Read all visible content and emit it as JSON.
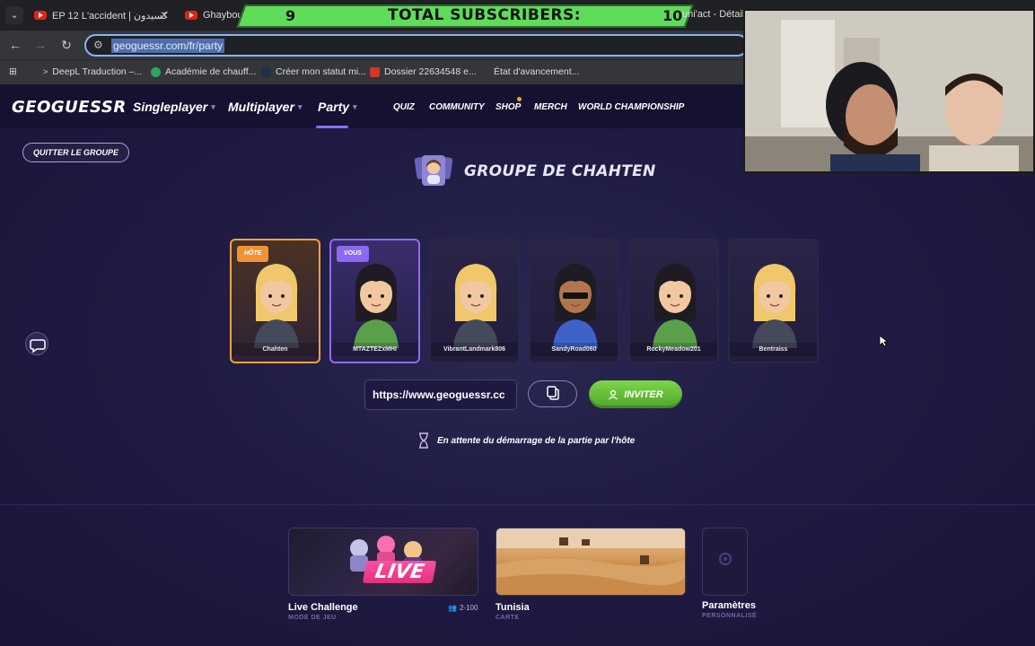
{
  "browser": {
    "tabs": [
      {
        "label": "EP 12 L'accident | كسيدون"
      },
      {
        "label": "Ghaybouba a"
      }
    ],
    "tab_right_text": "uni'act - Détails",
    "url": "geoguessr.com/fr/party",
    "bookmarks": [
      {
        "label": "DeepL Traduction –..."
      },
      {
        "label": "Académie de chauff..."
      },
      {
        "label": "Créer mon statut mi..."
      },
      {
        "label": "Dossier 22634548 e..."
      },
      {
        "label": "État d'avancement..."
      }
    ]
  },
  "subscriber_banner": {
    "left_count": "9",
    "title": "TOTAL SUBSCRIBERS:",
    "right_count": "10"
  },
  "header": {
    "logo": "GEOGUESSR",
    "nav_main": [
      {
        "label": "Singleplayer"
      },
      {
        "label": "Multiplayer"
      },
      {
        "label": "Party"
      }
    ],
    "nav_small": [
      {
        "label": "QUIZ"
      },
      {
        "label": "COMMUNITY"
      },
      {
        "label": "SHOP"
      },
      {
        "label": "MERCH"
      },
      {
        "label": "WORLD CHAMPIONSHIP"
      }
    ]
  },
  "party": {
    "quit_label": "QUITTER LE GROUPE",
    "title": "GROUPE DE CHAHTEN",
    "players": [
      {
        "name": "Chahten",
        "badge": "HÔTE",
        "hair": "#f0c76a",
        "shirt": "#444a5a",
        "skin": "#f2c8a0"
      },
      {
        "name": "MTAZTEZxMHI",
        "badge": "VOUS",
        "hair": "#1e1b22",
        "shirt": "#5aa04a",
        "skin": "#f2c8a0"
      },
      {
        "name": "VibrantLandmark806",
        "badge": "",
        "hair": "#f0c76a",
        "shirt": "#444a5a",
        "skin": "#f2c8a0"
      },
      {
        "name": "SandyRoad060",
        "badge": "",
        "hair": "#1e1b22",
        "shirt": "#3d63c9",
        "skin": "#b27550"
      },
      {
        "name": "RockyMeadow201",
        "badge": "",
        "hair": "#1e1b22",
        "shirt": "#5aa04a",
        "skin": "#f2c8a0"
      },
      {
        "name": "Bentraiss",
        "badge": "",
        "hair": "#f0c76a",
        "shirt": "#444a5a",
        "skin": "#f2c8a0"
      }
    ],
    "invite_url": "https://www.geoguessr.cc",
    "invite_label": "INVITER",
    "waiting_text": "En attente du démarrage de la partie par l'hôte"
  },
  "settings_cards": [
    {
      "title": "Live Challenge",
      "sub": "MODE DE JEU",
      "image_text": "LIVE",
      "players": "2-100"
    },
    {
      "title": "Tunisia",
      "sub": "CARTE"
    },
    {
      "title": "Paramètres",
      "sub": "PERSONNALISÉ"
    }
  ]
}
